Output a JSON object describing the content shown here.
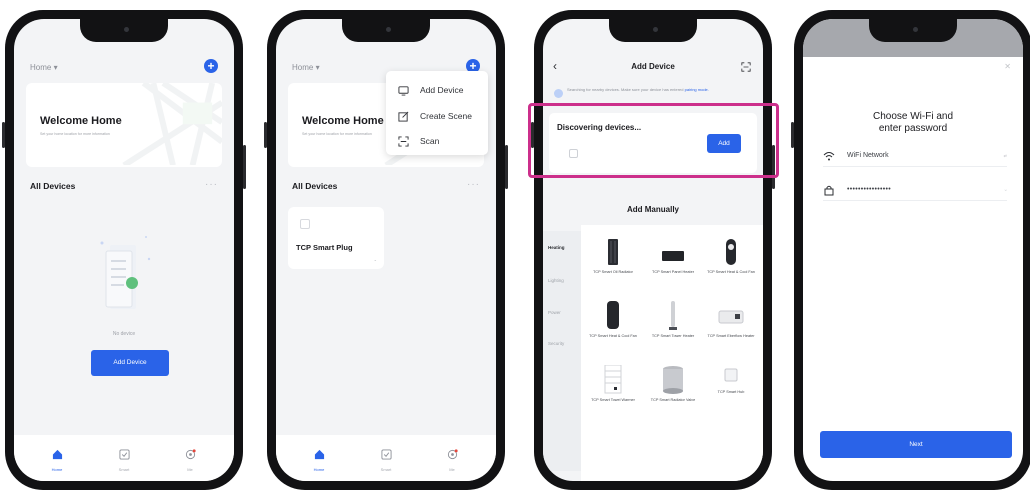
{
  "colors": {
    "accent": "#2a63e8",
    "highlight": "#cc2f8b",
    "phone_frame": "#121214"
  },
  "screen1": {
    "home_selector": "Home ▾",
    "welcome_title": "Welcome Home",
    "welcome_sub": "Set your home location for more information",
    "section_title": "All Devices",
    "more": "···",
    "empty_text": "No device",
    "add_button": "Add Device",
    "tabs": [
      {
        "label": "Home",
        "icon": "home-icon"
      },
      {
        "label": "Smart",
        "icon": "checklist-icon"
      },
      {
        "label": "Me",
        "icon": "profile-icon"
      }
    ]
  },
  "screen2": {
    "home_selector": "Home ▾",
    "welcome_title": "Welcome Home",
    "welcome_sub": "Set your home location for more information",
    "section_title": "All Devices",
    "more": "···",
    "menu": [
      {
        "label": "Add Device",
        "icon": "device-icon"
      },
      {
        "label": "Create Scene",
        "icon": "edit-icon"
      },
      {
        "label": "Scan",
        "icon": "scan-icon"
      }
    ],
    "device": {
      "name": "TCP Smart Plug",
      "arrow": "⌄"
    },
    "tabs": [
      {
        "label": "Home"
      },
      {
        "label": "Smart"
      },
      {
        "label": "Me"
      }
    ]
  },
  "screen3": {
    "title": "Add Device",
    "search_info": "Searching for nearby devices. Make sure your device has entered",
    "pairing_link": "pairing mode.",
    "discover_title": "Discovering devices...",
    "add_label": "Add",
    "manual_title": "Add Manually",
    "categories": [
      "Heating",
      "Lighting",
      "Power",
      "Security"
    ],
    "products": [
      {
        "name": "TCP Smart Oil Radiator"
      },
      {
        "name": "TCP Smart Panel Heater"
      },
      {
        "name": "TCP Smart Heat & Cool Fan"
      },
      {
        "name": "TCP Smart Heat & Cool Fan"
      },
      {
        "name": "TCP Smart Tower Heater"
      },
      {
        "name": "TCP Smart Eberflow Heater"
      },
      {
        "name": "TCP Smart Towel Warmer"
      },
      {
        "name": "TCP Smart Radiator Valve"
      },
      {
        "name": "TCP Smart Hub"
      }
    ]
  },
  "screen4": {
    "title_line1": "Choose Wi-Fi and",
    "title_line2": "enter password",
    "wifi_name": "WiFi Network",
    "wifi_end": "⇄",
    "password": "••••••••••••••••",
    "pw_end": "⌣",
    "next_label": "Next",
    "close": "✕"
  }
}
